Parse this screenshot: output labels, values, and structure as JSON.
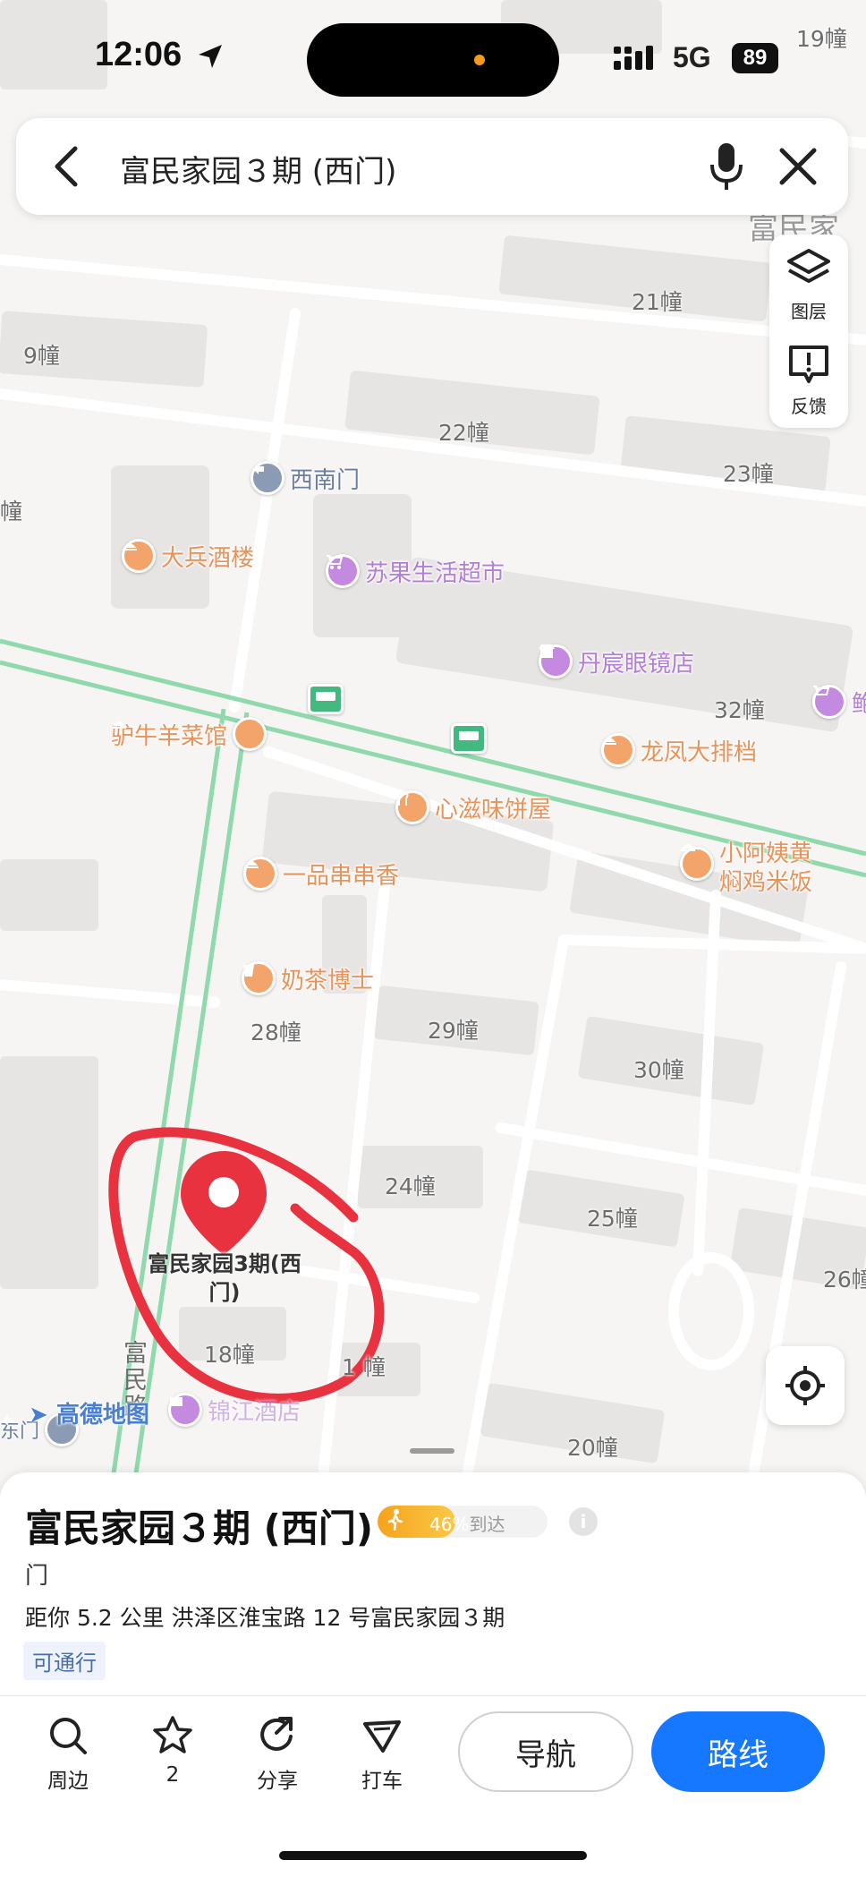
{
  "status_bar": {
    "time": "12:06",
    "network": "5G",
    "battery": "89"
  },
  "search": {
    "query": "富民家园３期 (西门)"
  },
  "map_tools": {
    "layers_label": "图层",
    "feedback_label": "反馈"
  },
  "map": {
    "buildings": [
      "19幢",
      "富民家",
      "21幢",
      "9幢",
      "22幢",
      "23幢",
      "32幢",
      "28幢",
      "29幢",
      "30幢",
      "24幢",
      "25幢",
      "26幢",
      "18幢",
      "1 幢",
      "20幢",
      "幢"
    ],
    "pois": {
      "gate": "西南门",
      "restaurant1": "大兵酒楼",
      "supermarket": "苏果生活超市",
      "optical": "丹宸眼镜店",
      "restaurant2": "驴牛羊菜馆",
      "restaurant3": "龙凤大排档",
      "restaurant4": "心滋味饼屋",
      "restaurant5_l1": "小阿姨黄",
      "restaurant5_l2": "焖鸡米饭",
      "restaurant6": "一品串串香",
      "tea": "奶茶博士",
      "hotel": "锦江酒店",
      "road": "富民路",
      "gate2": "东门",
      "shop_cut": "鲍"
    },
    "pin_label_l1": "富民家园3期(西",
    "pin_label_l2": "门)",
    "logo": "高德地图"
  },
  "place": {
    "title": "富民家园３期 (西门)",
    "reach_percent": "46%",
    "reach_value": 0.46,
    "reach_suffix": "到达",
    "category": "门",
    "distance_address": "距你 5.2 公里  洪泽区淮宝路 12 号富民家园３期",
    "tag": "可通行"
  },
  "actions": {
    "nearby": "周边",
    "favorite_count": "2",
    "share": "分享",
    "taxi": "打车",
    "navigate": "导航",
    "route": "路线"
  },
  "colors": {
    "accent": "#1677ff",
    "pin": "#e8323f",
    "annotation": "#e8323f",
    "road_green": "#8fd9ad"
  }
}
